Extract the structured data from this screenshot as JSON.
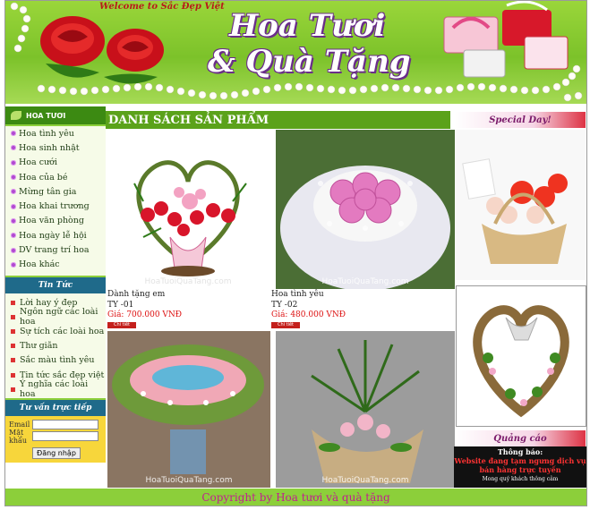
{
  "header": {
    "welcome": "Welcome to Sắc Đẹp Việt",
    "title_line1": "Hoa Tươi",
    "title_line2": "& Quà Tặng"
  },
  "sidebar": {
    "flowers_heading": "HOA TƯƠI",
    "menu": [
      "Hoa tình yêu",
      "Hoa sinh nhật",
      "Hoa cưới",
      "Hoa của bé",
      "Mừng tân gia",
      "Hoa khai trương",
      "Hoa văn phòng",
      "Hoa ngày lễ hội",
      "DV trang trí hoa",
      "Hoa khác"
    ],
    "news_heading": "Tin Tức",
    "news": [
      "Lời hay ý đẹp",
      "Ngôn ngữ các loài hoa",
      "Sự tích các loài hoa",
      "Thư giãn",
      "Sắc màu tình yêu",
      "Tin tức sắc đẹp việt",
      "Ý nghĩa các loài hoa"
    ],
    "consult_heading": "Tư vấn trực tiếp",
    "email_label": "Email",
    "password_label": "Mật khẩu",
    "login_button": "Đăng nhập"
  },
  "main": {
    "heading": "DANH SÁCH SẢN PHẨM",
    "watermark": "HoaTuoiQuaTang.com",
    "products": [
      {
        "name": "Dành tặng em",
        "code": "TY -01",
        "price": "Giá: 700.000 VNĐ",
        "detail": "Chi tiết"
      },
      {
        "name": "Hoa tình yêu",
        "code": "TY -02",
        "price": "Giá: 480.000 VNĐ",
        "detail": "Chi tiết"
      }
    ]
  },
  "right": {
    "special_day": "Special Day!",
    "ads_heading": "Quảng cáo",
    "ad_title": "Thông báo:",
    "ad_text": "Website đang tạm ngưng dịch vụ bán hàng trực tuyến",
    "ad_small": "Mong quý khách thông cảm"
  },
  "footer": {
    "copyright": "Copyright by Hoa tươi và quà tặng"
  },
  "colors": {
    "header_green": "#7cc22a",
    "menu_green": "#3c8a12",
    "news_blue": "#1f6a8a",
    "login_yellow": "#f7d63b",
    "price_red": "#d11111",
    "footer_text": "#c02090"
  }
}
